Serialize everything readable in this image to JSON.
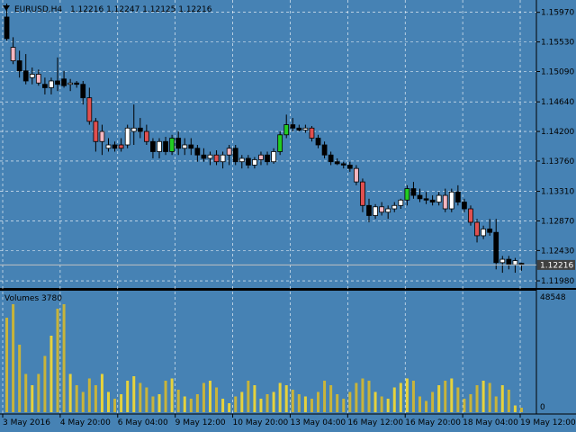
{
  "window": {
    "symbol_label": "EURUSD,H4",
    "ohlc_label": "1.12216 1.12247 1.12125 1.12216",
    "menu_arrow_icon": "triangle-down-icon"
  },
  "colors": {
    "background": "#4682b4",
    "grid": "#ffffff",
    "bull_body": "#ffffff",
    "bear_body": "#000000",
    "wick": "#000000",
    "highlight_up": "#22cc22",
    "highlight_down": "#e05050",
    "highlight_pink": "#f4b6c0",
    "volume_up": "#e6d23c",
    "volume_down": "#c8b43a",
    "price_line": "#c0c0c0",
    "price_tag_bg": "#404040"
  },
  "price_panel": {
    "current_price_label": "1.12216",
    "current_price": 1.12216,
    "price_ticks": [
      "1.15970",
      "1.15530",
      "1.15090",
      "1.14640",
      "1.14200",
      "1.13760",
      "1.13310",
      "1.12870",
      "1.12430",
      "1.11980"
    ]
  },
  "volume_panel": {
    "title": "Volumes 3780",
    "max_label": "48548",
    "zero_label": "0"
  },
  "time_axis": {
    "labels": [
      "3 May 2016",
      "4 May 20:00",
      "6 May 04:00",
      "9 May 12:00",
      "10 May 20:00",
      "13 May 04:00",
      "16 May 12:00",
      "16 May 20:00",
      "18 May 04:00",
      "19 May 12:00"
    ]
  },
  "chart_data": {
    "type": "candlestick",
    "title": "EURUSD,H4",
    "ylim": [
      1.119,
      1.161
    ],
    "candles": [
      {
        "o": 1.159,
        "h": 1.161,
        "l": 1.1555,
        "c": 1.1558
      },
      {
        "o": 1.1545,
        "h": 1.156,
        "l": 1.152,
        "c": 1.1525,
        "hl": "pink"
      },
      {
        "o": 1.1525,
        "h": 1.154,
        "l": 1.15,
        "c": 1.151
      },
      {
        "o": 1.151,
        "h": 1.1535,
        "l": 1.149,
        "c": 1.1495
      },
      {
        "o": 1.15,
        "h": 1.1515,
        "l": 1.149,
        "c": 1.1505
      },
      {
        "o": 1.1505,
        "h": 1.1512,
        "l": 1.1488,
        "c": 1.1492,
        "hl": "pink"
      },
      {
        "o": 1.149,
        "h": 1.15,
        "l": 1.1475,
        "c": 1.1485
      },
      {
        "o": 1.1485,
        "h": 1.15,
        "l": 1.1475,
        "c": 1.1495
      },
      {
        "o": 1.1495,
        "h": 1.153,
        "l": 1.148,
        "c": 1.149
      },
      {
        "o": 1.1498,
        "h": 1.151,
        "l": 1.1485,
        "c": 1.1488
      },
      {
        "o": 1.149,
        "h": 1.1498,
        "l": 1.148,
        "c": 1.1492
      },
      {
        "o": 1.1492,
        "h": 1.1495,
        "l": 1.1485,
        "c": 1.149
      },
      {
        "o": 1.149,
        "h": 1.1495,
        "l": 1.146,
        "c": 1.147
      },
      {
        "o": 1.147,
        "h": 1.1485,
        "l": 1.143,
        "c": 1.1435,
        "hl": "red"
      },
      {
        "o": 1.1435,
        "h": 1.144,
        "l": 1.139,
        "c": 1.1405,
        "hl": "red"
      },
      {
        "o": 1.1405,
        "h": 1.143,
        "l": 1.1385,
        "c": 1.142,
        "hl": "pink"
      },
      {
        "o": 1.1395,
        "h": 1.141,
        "l": 1.139,
        "c": 1.14
      },
      {
        "o": 1.14,
        "h": 1.1405,
        "l": 1.139,
        "c": 1.1395
      },
      {
        "o": 1.1395,
        "h": 1.141,
        "l": 1.139,
        "c": 1.14,
        "hl": "red"
      },
      {
        "o": 1.14,
        "h": 1.143,
        "l": 1.1395,
        "c": 1.1425
      },
      {
        "o": 1.142,
        "h": 1.146,
        "l": 1.14,
        "c": 1.1425
      },
      {
        "o": 1.1425,
        "h": 1.144,
        "l": 1.141,
        "c": 1.142
      },
      {
        "o": 1.142,
        "h": 1.143,
        "l": 1.14,
        "c": 1.1405,
        "hl": "red"
      },
      {
        "o": 1.1405,
        "h": 1.141,
        "l": 1.138,
        "c": 1.139
      },
      {
        "o": 1.139,
        "h": 1.141,
        "l": 1.138,
        "c": 1.1405
      },
      {
        "o": 1.1405,
        "h": 1.1412,
        "l": 1.1385,
        "c": 1.139
      },
      {
        "o": 1.139,
        "h": 1.1415,
        "l": 1.1385,
        "c": 1.141,
        "hl": "green"
      },
      {
        "o": 1.141,
        "h": 1.142,
        "l": 1.1385,
        "c": 1.1395
      },
      {
        "o": 1.1395,
        "h": 1.141,
        "l": 1.1385,
        "c": 1.14
      },
      {
        "o": 1.14,
        "h": 1.141,
        "l": 1.1385,
        "c": 1.1395
      },
      {
        "o": 1.1395,
        "h": 1.14,
        "l": 1.1375,
        "c": 1.1385
      },
      {
        "o": 1.1385,
        "h": 1.1395,
        "l": 1.1375,
        "c": 1.138
      },
      {
        "o": 1.138,
        "h": 1.139,
        "l": 1.137,
        "c": 1.1385
      },
      {
        "o": 1.1385,
        "h": 1.1392,
        "l": 1.137,
        "c": 1.1375,
        "hl": "red"
      },
      {
        "o": 1.1375,
        "h": 1.139,
        "l": 1.1365,
        "c": 1.1385
      },
      {
        "o": 1.1385,
        "h": 1.14,
        "l": 1.137,
        "c": 1.1395,
        "hl": "pink"
      },
      {
        "o": 1.1395,
        "h": 1.14,
        "l": 1.137,
        "c": 1.1375
      },
      {
        "o": 1.1375,
        "h": 1.1385,
        "l": 1.1365,
        "c": 1.138
      },
      {
        "o": 1.138,
        "h": 1.1385,
        "l": 1.1365,
        "c": 1.137
      },
      {
        "o": 1.137,
        "h": 1.1382,
        "l": 1.1365,
        "c": 1.1378
      },
      {
        "o": 1.1378,
        "h": 1.139,
        "l": 1.137,
        "c": 1.1385,
        "hl": "pink"
      },
      {
        "o": 1.1385,
        "h": 1.139,
        "l": 1.137,
        "c": 1.1375
      },
      {
        "o": 1.1375,
        "h": 1.1395,
        "l": 1.1372,
        "c": 1.139
      },
      {
        "o": 1.139,
        "h": 1.142,
        "l": 1.1385,
        "c": 1.1415,
        "hl": "green"
      },
      {
        "o": 1.1415,
        "h": 1.1445,
        "l": 1.141,
        "c": 1.143,
        "hl": "green"
      },
      {
        "o": 1.143,
        "h": 1.144,
        "l": 1.142,
        "c": 1.1425
      },
      {
        "o": 1.1425,
        "h": 1.143,
        "l": 1.142,
        "c": 1.1422
      },
      {
        "o": 1.1422,
        "h": 1.143,
        "l": 1.1418,
        "c": 1.1425
      },
      {
        "o": 1.1425,
        "h": 1.1428,
        "l": 1.1405,
        "c": 1.141,
        "hl": "red"
      },
      {
        "o": 1.141,
        "h": 1.1415,
        "l": 1.1395,
        "c": 1.14
      },
      {
        "o": 1.14,
        "h": 1.1405,
        "l": 1.138,
        "c": 1.1385
      },
      {
        "o": 1.1385,
        "h": 1.139,
        "l": 1.137,
        "c": 1.1375
      },
      {
        "o": 1.1375,
        "h": 1.138,
        "l": 1.137,
        "c": 1.1372
      },
      {
        "o": 1.1372,
        "h": 1.1375,
        "l": 1.1365,
        "c": 1.137
      },
      {
        "o": 1.137,
        "h": 1.1375,
        "l": 1.136,
        "c": 1.1365
      },
      {
        "o": 1.1365,
        "h": 1.137,
        "l": 1.134,
        "c": 1.1345,
        "hl": "pink"
      },
      {
        "o": 1.1345,
        "h": 1.135,
        "l": 1.13,
        "c": 1.131,
        "hl": "red"
      },
      {
        "o": 1.131,
        "h": 1.132,
        "l": 1.1285,
        "c": 1.1295
      },
      {
        "o": 1.1295,
        "h": 1.1312,
        "l": 1.129,
        "c": 1.1308
      },
      {
        "o": 1.1308,
        "h": 1.1315,
        "l": 1.1295,
        "c": 1.13,
        "hl": "pink"
      },
      {
        "o": 1.13,
        "h": 1.131,
        "l": 1.129,
        "c": 1.1305
      },
      {
        "o": 1.1305,
        "h": 1.1315,
        "l": 1.13,
        "c": 1.131
      },
      {
        "o": 1.131,
        "h": 1.132,
        "l": 1.1305,
        "c": 1.1318
      },
      {
        "o": 1.1318,
        "h": 1.134,
        "l": 1.131,
        "c": 1.1335,
        "hl": "green"
      },
      {
        "o": 1.1335,
        "h": 1.1345,
        "l": 1.132,
        "c": 1.1325
      },
      {
        "o": 1.1325,
        "h": 1.1335,
        "l": 1.1315,
        "c": 1.132
      },
      {
        "o": 1.132,
        "h": 1.133,
        "l": 1.1312,
        "c": 1.1318
      },
      {
        "o": 1.1318,
        "h": 1.1325,
        "l": 1.131,
        "c": 1.1315
      },
      {
        "o": 1.1315,
        "h": 1.133,
        "l": 1.131,
        "c": 1.1325
      },
      {
        "o": 1.1325,
        "h": 1.1335,
        "l": 1.13,
        "c": 1.1305,
        "hl": "pink"
      },
      {
        "o": 1.1305,
        "h": 1.1335,
        "l": 1.13,
        "c": 1.133
      },
      {
        "o": 1.133,
        "h": 1.134,
        "l": 1.131,
        "c": 1.1315
      },
      {
        "o": 1.1315,
        "h": 1.132,
        "l": 1.13,
        "c": 1.1305
      },
      {
        "o": 1.1305,
        "h": 1.131,
        "l": 1.128,
        "c": 1.1285,
        "hl": "red"
      },
      {
        "o": 1.1285,
        "h": 1.129,
        "l": 1.1255,
        "c": 1.1265,
        "hl": "red"
      },
      {
        "o": 1.1265,
        "h": 1.128,
        "l": 1.126,
        "c": 1.1275
      },
      {
        "o": 1.1275,
        "h": 1.129,
        "l": 1.1265,
        "c": 1.127
      },
      {
        "o": 1.127,
        "h": 1.129,
        "l": 1.1215,
        "c": 1.1225
      },
      {
        "o": 1.1225,
        "h": 1.1235,
        "l": 1.121,
        "c": 1.123
      },
      {
        "o": 1.123,
        "h": 1.1235,
        "l": 1.1215,
        "c": 1.1222
      },
      {
        "o": 1.1222,
        "h": 1.1232,
        "l": 1.121,
        "c": 1.1228
      },
      {
        "o": 1.1224,
        "h": 1.1225,
        "l": 1.1213,
        "c": 1.1222
      }
    ],
    "volumes": [
      42,
      48,
      30,
      17,
      12,
      17,
      25,
      34,
      46,
      48,
      17,
      12,
      9,
      15,
      12,
      17,
      9,
      6,
      8,
      14,
      16,
      13,
      11,
      7,
      8,
      14,
      15,
      10,
      7,
      6,
      8,
      13,
      14,
      11,
      6,
      4,
      7,
      9,
      14,
      12,
      6,
      8,
      9,
      13,
      12,
      10,
      8,
      7,
      6,
      9,
      14,
      12,
      8,
      6,
      9,
      13,
      15,
      14,
      9,
      7,
      6,
      11,
      13,
      15,
      14,
      7,
      5,
      9,
      12,
      14,
      15,
      11,
      6,
      8,
      12,
      14,
      13,
      7,
      12,
      10,
      3,
      2
    ]
  }
}
